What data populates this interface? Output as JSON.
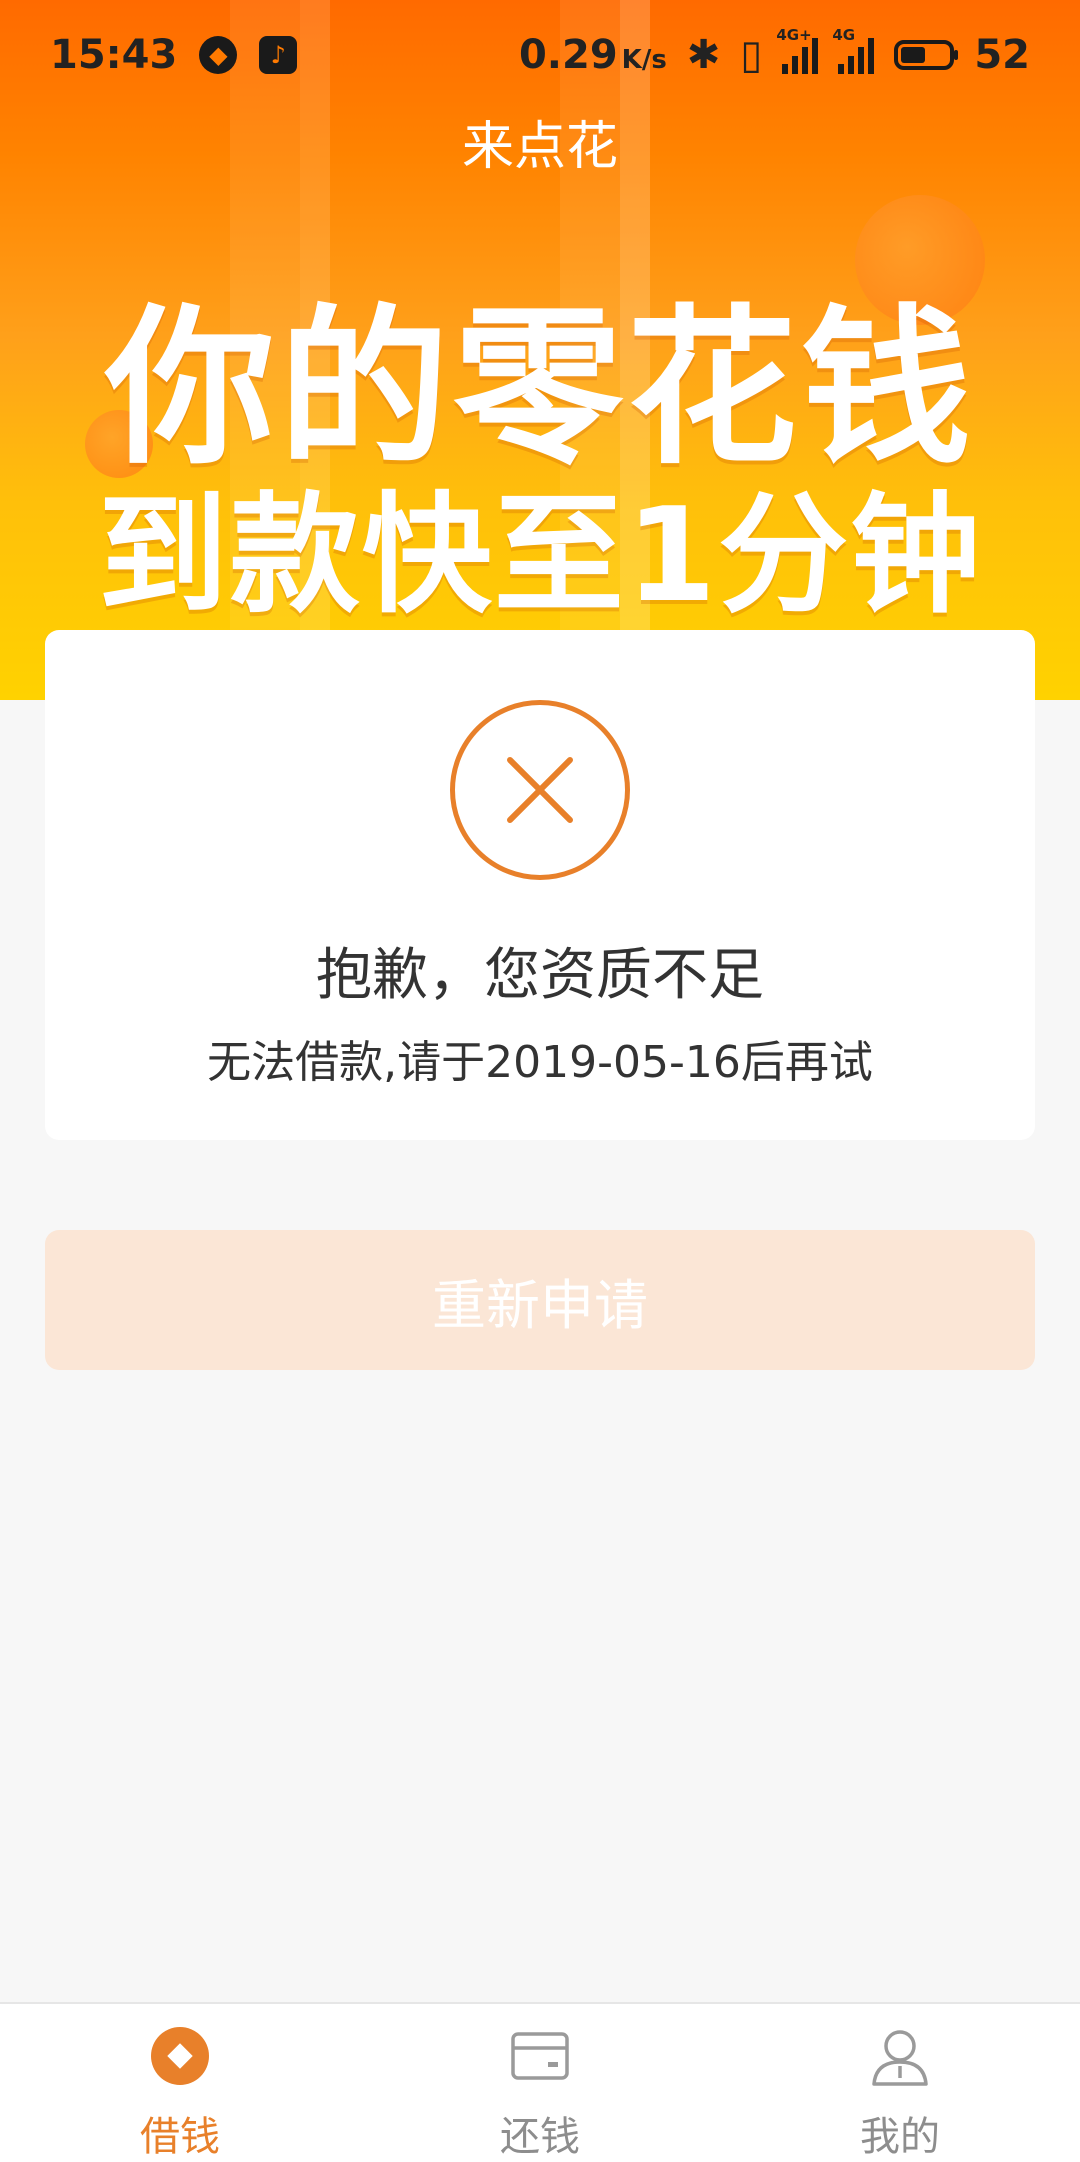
{
  "status_bar": {
    "time": "15:43",
    "net_speed": "0.29",
    "net_speed_unit": "K/s",
    "battery_level": "52",
    "battery_fraction": 0.52,
    "net_tag_1": "4G+",
    "net_tag_2": "4G"
  },
  "header": {
    "title": "来点花"
  },
  "banner": {
    "slogan_line1": "你的零花钱",
    "slogan_line2": "到款快至1分钟"
  },
  "result": {
    "title": "抱歉，您资质不足",
    "description": "无法借款,请于2019-05-16后再试"
  },
  "actions": {
    "reapply_label": "重新申请"
  },
  "bottom_nav": {
    "items": [
      {
        "label": "借钱",
        "icon": "borrow-icon",
        "active": true
      },
      {
        "label": "还钱",
        "icon": "card-icon",
        "active": false
      },
      {
        "label": "我的",
        "icon": "user-icon",
        "active": false
      }
    ]
  },
  "colors": {
    "accent": "#e8802a",
    "banner_top": "#ff6a00",
    "banner_bottom": "#ffd200",
    "button_disabled": "#fbe6d6"
  }
}
